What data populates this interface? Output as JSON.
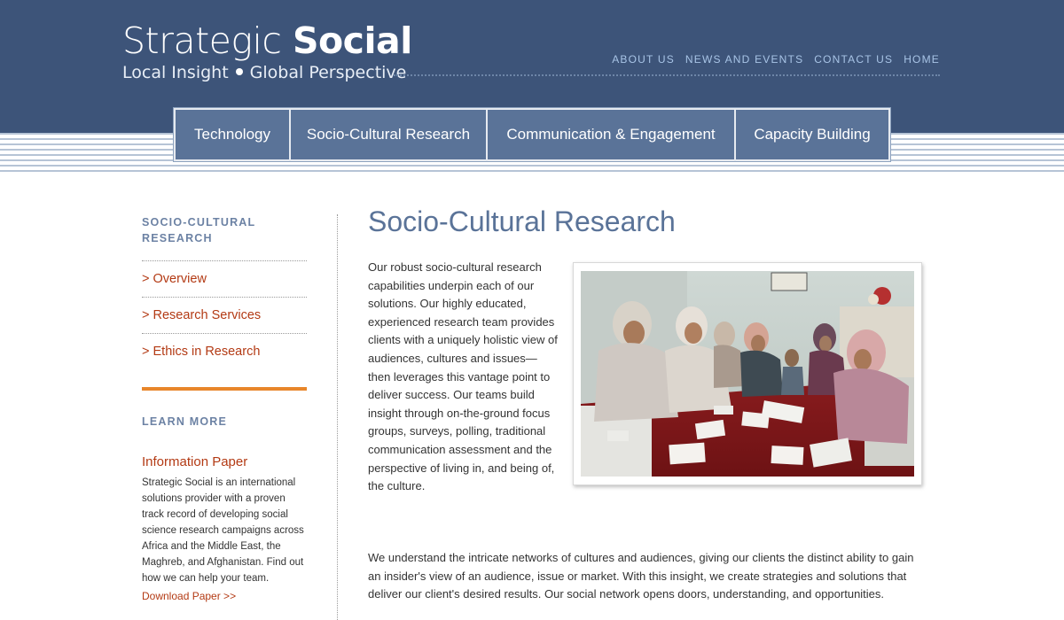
{
  "brand": {
    "name_light": "Strategic",
    "name_bold": "Social",
    "tagline_left": "Local Insight",
    "tagline_right": "Global Perspective"
  },
  "topnav": [
    "ABOUT US",
    "NEWS AND EVENTS",
    "CONTACT US",
    "HOME"
  ],
  "mainnav": [
    "Technology",
    "Socio-Cultural Research",
    "Communication & Engagement",
    "Capacity Building"
  ],
  "sidebar": {
    "heading_line1": "SOCIO-CULTURAL",
    "heading_line2": "RESEARCH",
    "links": [
      "> Overview",
      "> Research Services",
      "> Ethics in Research"
    ],
    "learn_more": "LEARN MORE",
    "info_title": "Information Paper",
    "info_text": "Strategic Social is an international solutions provider with a proven track record of developing social science research campaigns across Africa and the Middle East, the Maghreb, and Afghanistan. Find out how we can help your team.",
    "download": "Download Paper >>"
  },
  "content": {
    "title": "Socio-Cultural Research",
    "para1": "Our robust socio-cultural research capabilities underpin each of our solutions. Our highly educated, experienced research team provides clients with a uniquely holistic view of audiences, cultures and issues—then leverages this vantage point to deliver success. Our teams build insight through on-the-ground focus groups, surveys, polling, traditional communication assessment and the perspective of living in, and being of, the culture.",
    "para2": "We understand the intricate networks of cultures and audiences, giving our clients the distinct ability to gain an insider's view of an audience, issue or market. With this insight, we create strategies and solutions that deliver our client's desired results. Our social network opens doors, understanding, and opportunities."
  },
  "colors": {
    "header": "#3d5479",
    "tab": "#5a7398",
    "accent_link": "#b33a14",
    "orange": "#e8862a"
  }
}
